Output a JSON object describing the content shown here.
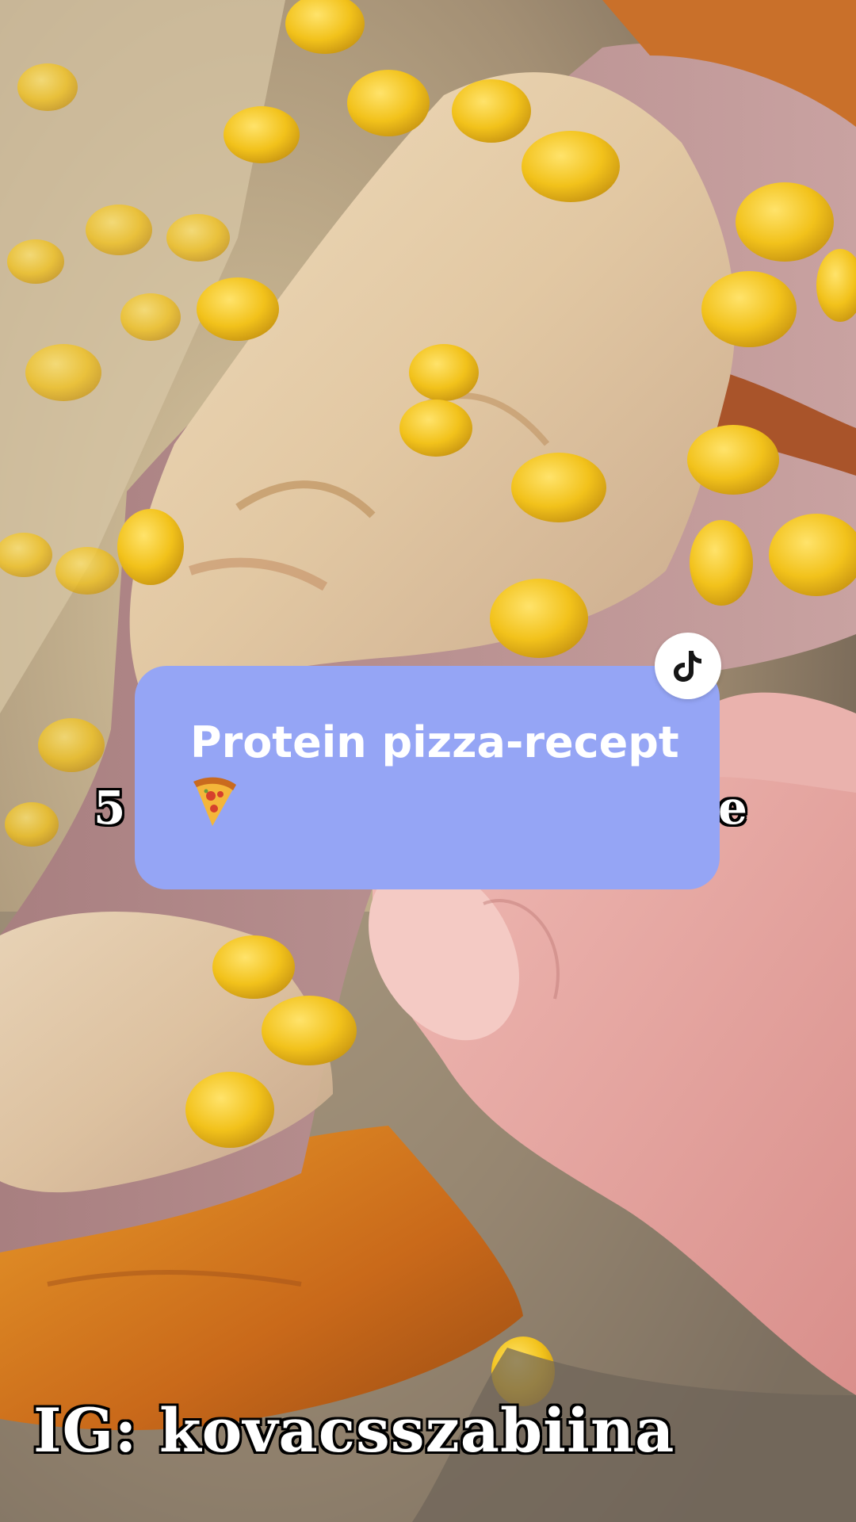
{
  "card": {
    "title": "Protein pizza-recept",
    "emoji_icon": "pizza-slice-icon",
    "background": "#95a5f5",
    "badge_icon": "tiktok-logo-icon"
  },
  "captions": {
    "left_fragment": "5",
    "right_fragment": "e",
    "instagram_handle": "IG: kovacsszabiina"
  },
  "colors": {
    "corn": "#f2c21b",
    "cheese": "#e9d6b4",
    "ham": "#b89191",
    "crust": "#d9821e",
    "hand": "#e9a9a4"
  }
}
